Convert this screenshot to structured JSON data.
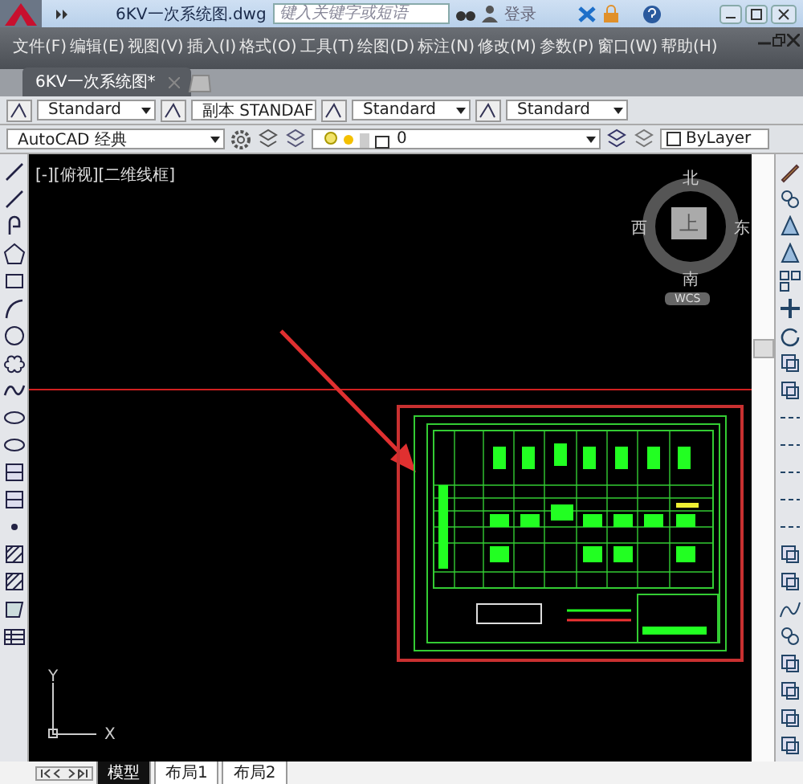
{
  "title_bar": {
    "file_name": "6KV一次系统图.dwg",
    "search": {
      "placeholder": "键入关键字或短语"
    },
    "sign_in": "登录"
  },
  "menu": [
    {
      "label": "文件(F)"
    },
    {
      "label": "编辑(E)"
    },
    {
      "label": "视图(V)"
    },
    {
      "label": "插入(I)"
    },
    {
      "label": "格式(O)"
    },
    {
      "label": "工具(T)"
    },
    {
      "label": "绘图(D)"
    },
    {
      "label": "标注(N)"
    },
    {
      "label": "修改(M)"
    },
    {
      "label": "参数(P)"
    },
    {
      "label": "窗口(W)"
    },
    {
      "label": "帮助(H)"
    }
  ],
  "doc_tabs": [
    {
      "label": "6KV一次系统图*",
      "selected": true
    }
  ],
  "toolbar": {
    "styles": [
      "Standard",
      "副本 STANDAF",
      "Standard",
      "Standard"
    ],
    "workspace": "AutoCAD 经典",
    "layer": "0",
    "color_control": "ByLayer"
  },
  "viewport": {
    "label": "[-][俯视][二维线框]",
    "viewcube": {
      "north": "北",
      "east": "东",
      "south": "南",
      "west": "西",
      "top": "上",
      "ucs": "WCS"
    },
    "axes": {
      "x": "X",
      "y": "Y"
    }
  },
  "layout_tabs": [
    {
      "label": "模型",
      "selected": true
    },
    {
      "label": "布局1",
      "selected": false
    },
    {
      "label": "布局2",
      "selected": false
    }
  ]
}
